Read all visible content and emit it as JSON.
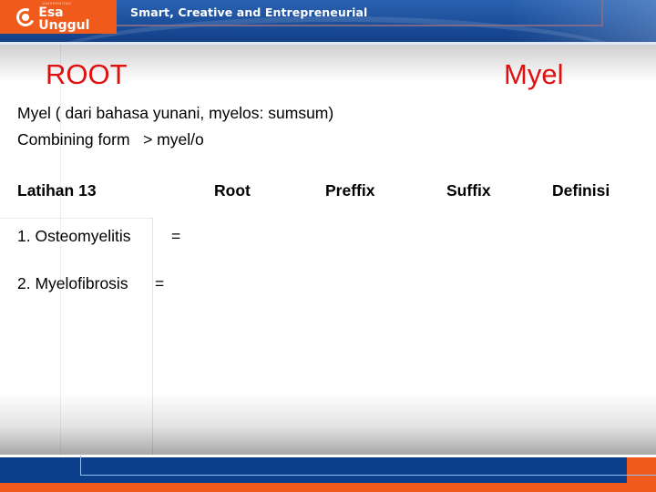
{
  "header": {
    "logo_small_text": "UNIVERSITAS",
    "logo_text": "Esa Unggul",
    "tagline": "Smart, Creative and Entrepreneurial"
  },
  "slide": {
    "title_left": "ROOT",
    "title_right": "Myel",
    "lines": [
      "Myel ( dari bahasa yunani, myelos: sumsum)",
      "Combining form   > myel/o"
    ],
    "columns": [
      "Latihan 13",
      "Root",
      "Preffix",
      "Suffix",
      "Definisi"
    ],
    "items": [
      {
        "label": "1. Osteomyelitis",
        "eq": "="
      },
      {
        "label": "2. Myelofibrosis",
        "eq": "="
      }
    ]
  },
  "colors": {
    "brand_orange": "#f05a1a",
    "brand_blue": "#0b3f8c",
    "title_red": "#e01010"
  }
}
